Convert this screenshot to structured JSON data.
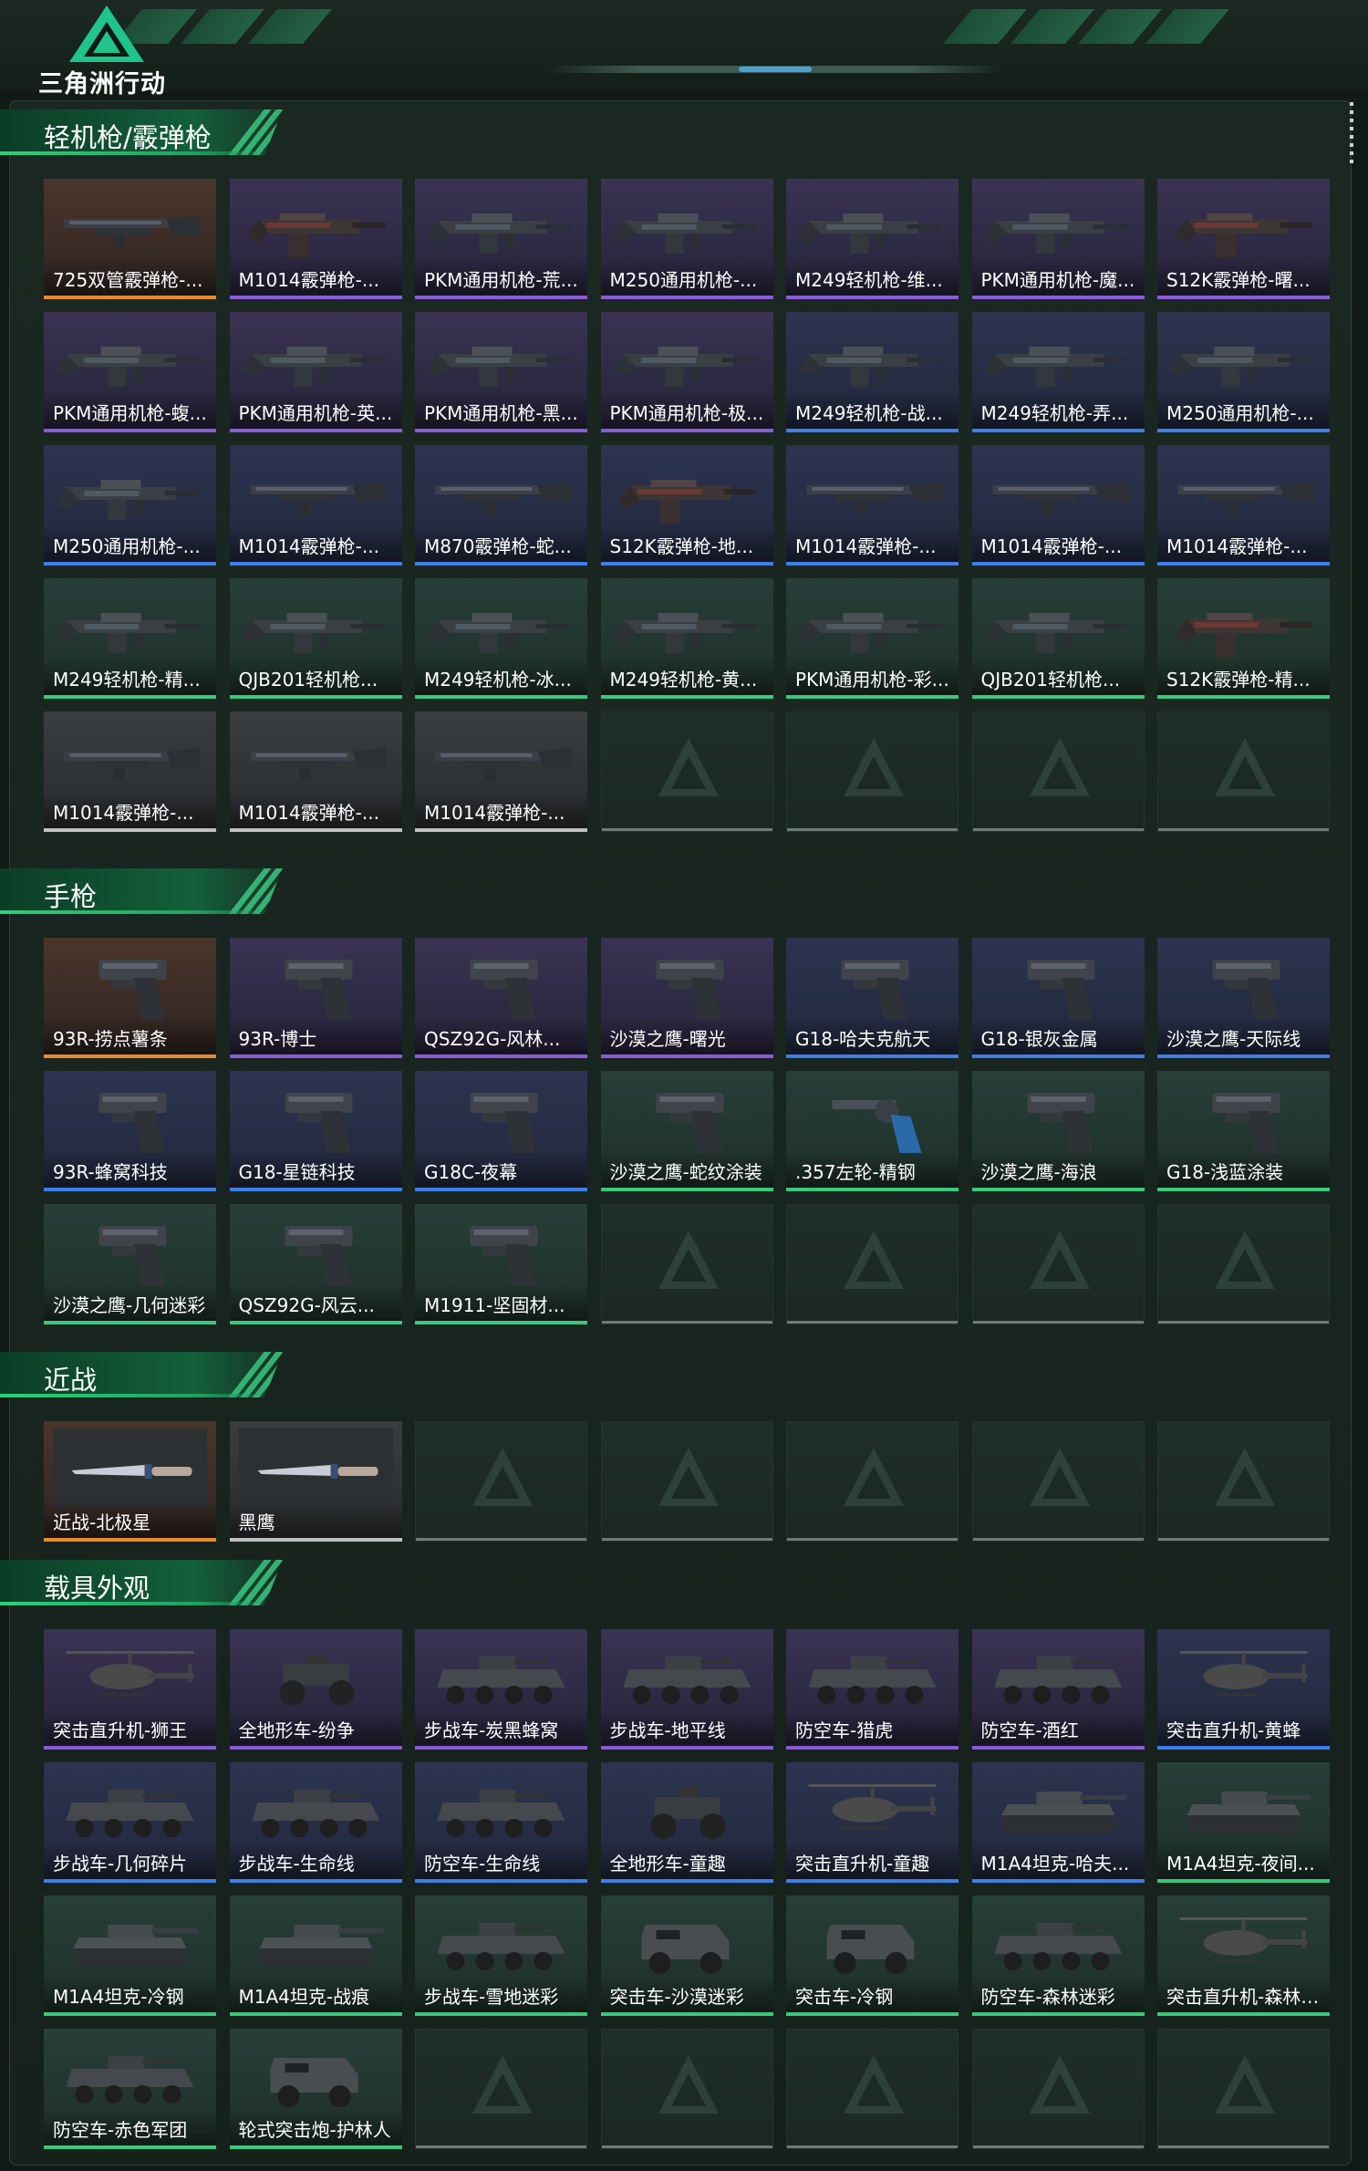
{
  "app": {
    "logo_text": "三角洲行动"
  },
  "sections": [
    {
      "title": "轻机枪/霰弹枪",
      "items": [
        {
          "label": "725双管霰弹枪-...",
          "rarity": "orange",
          "icon": "shotgun"
        },
        {
          "label": "M1014霰弹枪-...",
          "rarity": "purple",
          "icon": "rifle"
        },
        {
          "label": "PKM通用机枪-荒...",
          "rarity": "purple",
          "icon": "lmg"
        },
        {
          "label": "M250通用机枪-...",
          "rarity": "purple",
          "icon": "lmg"
        },
        {
          "label": "M249轻机枪-维...",
          "rarity": "purple",
          "icon": "lmg"
        },
        {
          "label": "PKM通用机枪-魔...",
          "rarity": "purple",
          "icon": "lmg"
        },
        {
          "label": "S12K霰弹枪-曙...",
          "rarity": "purple",
          "icon": "rifle"
        },
        {
          "label": "PKM通用机枪-蝮...",
          "rarity": "purple",
          "icon": "lmg"
        },
        {
          "label": "PKM通用机枪-英...",
          "rarity": "purple",
          "icon": "lmg"
        },
        {
          "label": "PKM通用机枪-黑...",
          "rarity": "purple",
          "icon": "lmg"
        },
        {
          "label": "PKM通用机枪-极...",
          "rarity": "purple",
          "icon": "lmg"
        },
        {
          "label": "M249轻机枪-战...",
          "rarity": "blue",
          "icon": "lmg"
        },
        {
          "label": "M249轻机枪-弄...",
          "rarity": "blue",
          "icon": "lmg"
        },
        {
          "label": "M250通用机枪-...",
          "rarity": "blue",
          "icon": "lmg"
        },
        {
          "label": "M250通用机枪-...",
          "rarity": "blue",
          "icon": "lmg"
        },
        {
          "label": "M1014霰弹枪-...",
          "rarity": "blue",
          "icon": "shotgun"
        },
        {
          "label": "M870霰弹枪-蛇...",
          "rarity": "blue",
          "icon": "shotgun"
        },
        {
          "label": "S12K霰弹枪-地...",
          "rarity": "blue",
          "icon": "rifle"
        },
        {
          "label": "M1014霰弹枪-...",
          "rarity": "blue",
          "icon": "shotgun"
        },
        {
          "label": "M1014霰弹枪-...",
          "rarity": "blue",
          "icon": "shotgun"
        },
        {
          "label": "M1014霰弹枪-...",
          "rarity": "blue",
          "icon": "shotgun"
        },
        {
          "label": "M249轻机枪-精...",
          "rarity": "green",
          "icon": "lmg"
        },
        {
          "label": "QJB201轻机枪...",
          "rarity": "green",
          "icon": "lmg"
        },
        {
          "label": "M249轻机枪-冰...",
          "rarity": "green",
          "icon": "lmg"
        },
        {
          "label": "M249轻机枪-黄...",
          "rarity": "green",
          "icon": "lmg"
        },
        {
          "label": "PKM通用机枪-彩...",
          "rarity": "green",
          "icon": "lmg"
        },
        {
          "label": "QJB201轻机枪...",
          "rarity": "green",
          "icon": "lmg"
        },
        {
          "label": "S12K霰弹枪-精...",
          "rarity": "green",
          "icon": "rifle"
        },
        {
          "label": "M1014霰弹枪-...",
          "rarity": "grey",
          "icon": "shotgun"
        },
        {
          "label": "M1014霰弹枪-...",
          "rarity": "grey",
          "icon": "shotgun"
        },
        {
          "label": "M1014霰弹枪-...",
          "rarity": "grey",
          "icon": "shotgun"
        }
      ],
      "empty_slots": 4
    },
    {
      "title": "手枪",
      "items": [
        {
          "label": "93R-捞点薯条",
          "rarity": "orange",
          "icon": "pistol"
        },
        {
          "label": "93R-博士",
          "rarity": "purple",
          "icon": "pistol"
        },
        {
          "label": "QSZ92G-风林...",
          "rarity": "purple",
          "icon": "pistol"
        },
        {
          "label": "沙漠之鹰-曙光",
          "rarity": "purple",
          "icon": "pistol"
        },
        {
          "label": "G18-哈夫克航天",
          "rarity": "blue",
          "icon": "pistol"
        },
        {
          "label": "G18-银灰金属",
          "rarity": "blue",
          "icon": "pistol"
        },
        {
          "label": "沙漠之鹰-天际线",
          "rarity": "blue",
          "icon": "pistol"
        },
        {
          "label": "93R-蜂窝科技",
          "rarity": "blue",
          "icon": "pistol"
        },
        {
          "label": "G18-星链科技",
          "rarity": "blue",
          "icon": "pistol"
        },
        {
          "label": "G18C-夜幕",
          "rarity": "blue",
          "icon": "pistol"
        },
        {
          "label": "沙漠之鹰-蛇纹涂装",
          "rarity": "green",
          "icon": "pistol"
        },
        {
          "label": ".357左轮-精钢",
          "rarity": "green",
          "icon": "revolver"
        },
        {
          "label": "沙漠之鹰-海浪",
          "rarity": "green",
          "icon": "pistol"
        },
        {
          "label": "G18-浅蓝涂装",
          "rarity": "green",
          "icon": "pistol"
        },
        {
          "label": "沙漠之鹰-几何迷彩",
          "rarity": "green",
          "icon": "pistol"
        },
        {
          "label": "QSZ92G-风云...",
          "rarity": "green",
          "icon": "pistol"
        },
        {
          "label": "M1911-坚固材...",
          "rarity": "green",
          "icon": "pistol"
        }
      ],
      "empty_slots": 4
    },
    {
      "title": "近战",
      "items": [
        {
          "label": "近战-北极星",
          "rarity": "orange",
          "icon": "knife"
        },
        {
          "label": "黑鹰",
          "rarity": "grey",
          "icon": "knife"
        }
      ],
      "empty_slots": 5
    },
    {
      "title": "载具外观",
      "items": [
        {
          "label": "突击直升机-狮王",
          "rarity": "purple",
          "icon": "helicopter"
        },
        {
          "label": "全地形车-纷争",
          "rarity": "purple",
          "icon": "atv"
        },
        {
          "label": "步战车-炭黑蜂窝",
          "rarity": "purple",
          "icon": "apc"
        },
        {
          "label": "步战车-地平线",
          "rarity": "purple",
          "icon": "apc"
        },
        {
          "label": "防空车-猎虎",
          "rarity": "purple",
          "icon": "apc"
        },
        {
          "label": "防空车-酒红",
          "rarity": "purple",
          "icon": "apc"
        },
        {
          "label": "突击直升机-黄蜂",
          "rarity": "blue",
          "icon": "helicopter"
        },
        {
          "label": "步战车-几何碎片",
          "rarity": "blue",
          "icon": "apc"
        },
        {
          "label": "步战车-生命线",
          "rarity": "blue",
          "icon": "apc"
        },
        {
          "label": "防空车-生命线",
          "rarity": "blue",
          "icon": "apc"
        },
        {
          "label": "全地形车-童趣",
          "rarity": "blue",
          "icon": "atv"
        },
        {
          "label": "突击直升机-童趣",
          "rarity": "blue",
          "icon": "helicopter"
        },
        {
          "label": "M1A4坦克-哈夫...",
          "rarity": "blue",
          "icon": "tank"
        },
        {
          "label": "M1A4坦克-夜间...",
          "rarity": "green",
          "icon": "tank"
        },
        {
          "label": "M1A4坦克-冷钢",
          "rarity": "green",
          "icon": "tank"
        },
        {
          "label": "M1A4坦克-战痕",
          "rarity": "green",
          "icon": "tank"
        },
        {
          "label": "步战车-雪地迷彩",
          "rarity": "green",
          "icon": "apc"
        },
        {
          "label": "突击车-沙漠迷彩",
          "rarity": "green",
          "icon": "truck"
        },
        {
          "label": "突击车-冷钢",
          "rarity": "green",
          "icon": "truck"
        },
        {
          "label": "防空车-森林迷彩",
          "rarity": "green",
          "icon": "apc"
        },
        {
          "label": "突击直升机-森林迷...",
          "rarity": "green",
          "icon": "helicopter"
        },
        {
          "label": "防空车-赤色军团",
          "rarity": "green",
          "icon": "apc"
        },
        {
          "label": "轮式突击炮-护林人",
          "rarity": "green",
          "icon": "truck"
        }
      ],
      "empty_slots": 5
    }
  ],
  "colors": {
    "accent": "#2ed17a",
    "rarity_orange": "#e68a2e",
    "rarity_purple": "#8a5bd6",
    "rarity_blue": "#3f7ee8",
    "rarity_green": "#38c97a",
    "rarity_grey": "#bfbfbf"
  }
}
